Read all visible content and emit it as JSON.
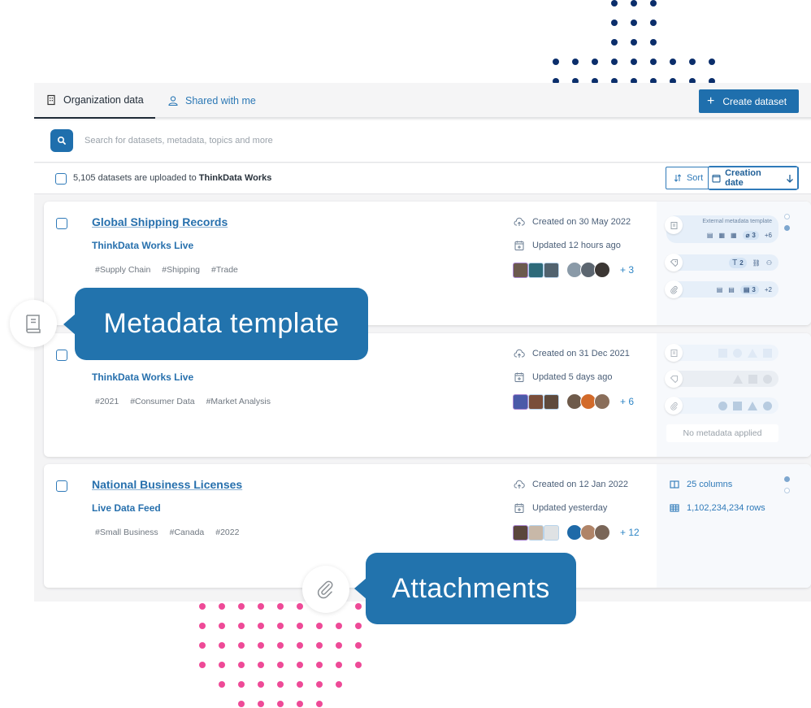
{
  "tabs": [
    {
      "label": "Organization data",
      "icon": "building-icon",
      "active": true
    },
    {
      "label": "Shared with me",
      "icon": "user-icon",
      "active": false
    }
  ],
  "create_button": {
    "label": "Create dataset",
    "icon": "plus-icon"
  },
  "search": {
    "placeholder": "Search for datasets, metadata, topics and more",
    "value": ""
  },
  "summary": {
    "count": "5,105",
    "middle": "datasets are uploaded to",
    "org": "ThinkData Works"
  },
  "sort": {
    "label": "Sort",
    "selected": "Creation date",
    "direction": "descending"
  },
  "datasets": [
    {
      "title": "Global Shipping Records",
      "source": "ThinkData Works Live",
      "tags": [
        "#Supply Chain",
        "#Shipping",
        "#Trade"
      ],
      "created": "Created on 30 May 2022",
      "updated": "Updated 12 hours ago",
      "more_users": "+ 3",
      "metadata": {
        "template_label": "External metadata template",
        "template_count": "3",
        "template_more": "+6",
        "tags_count": "2",
        "attachments_count": "3",
        "attachments_more": "+2"
      },
      "page_indicator": {
        "pages": 2,
        "current": 2
      }
    },
    {
      "title": "",
      "source": "ThinkData Works Live",
      "tags": [
        "#2021",
        "#Consumer Data",
        "#Market Analysis"
      ],
      "created": "Created on 31 Dec 2021",
      "updated": "Updated 5 days ago",
      "more_users": "+ 6",
      "metadata": {
        "empty_label": "No metadata applied"
      }
    },
    {
      "title": "National Business Licenses",
      "source": "Live Data Feed",
      "tags": [
        "#Small Business",
        "#Canada",
        "#2022"
      ],
      "created": "Created on 12 Jan 2022",
      "updated": "Updated yesterday",
      "more_users": "+ 12",
      "stats": {
        "columns": "25 columns",
        "rows": "1,102,234,234 rows"
      },
      "page_indicator": {
        "pages": 2,
        "current": 1
      }
    }
  ],
  "callouts": {
    "metadata_template": "Metadata template",
    "attachments": "Attachments"
  },
  "colors": {
    "brand": "#1f6fad",
    "link": "#2770ad",
    "callout": "#2273ad",
    "accent_dots_navy": "#0b2e6b",
    "accent_dots_pink": "#ee4a97"
  }
}
